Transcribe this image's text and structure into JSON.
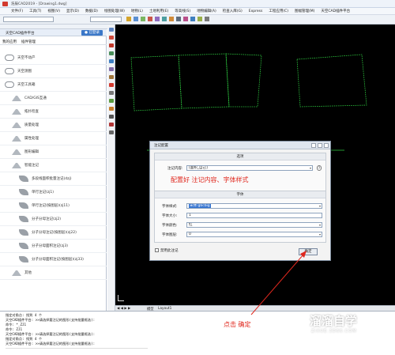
{
  "window": {
    "title": "浩辰CAD2019 - [Drawing1.dwg]"
  },
  "menu": [
    "文件(F)",
    "工具(T)",
    "视图(V)",
    "显示(D)",
    "数据(D)",
    "绘图处理(W)",
    "地物(L)",
    "土地利用(E)",
    "等高线(S)",
    "地物编辑(A)",
    "检查入库(G)",
    "Express",
    "工程应用(C)",
    "图幅管理(M)",
    "天空CAD插件平台"
  ],
  "panel": {
    "title": "天空CAD插件平台",
    "login": "已登录",
    "tabs": [
      "我的应用",
      "插件管理"
    ],
    "items": [
      {
        "label": "天空不动产",
        "icon": "cloud-icon",
        "level": 0
      },
      {
        "label": "天空测图",
        "icon": "cloud-icon",
        "level": 0
      },
      {
        "label": "天空工具箱",
        "icon": "cloud-icon",
        "level": 0
      },
      {
        "label": "CAD/GIS互通",
        "icon": "paper-plane-icon",
        "level": 1
      },
      {
        "label": "拓扑检查",
        "icon": "paper-plane-icon",
        "level": 1
      },
      {
        "label": "质量处理",
        "icon": "paper-plane-icon",
        "level": 1
      },
      {
        "label": "属性处理",
        "icon": "paper-plane-icon",
        "level": 1
      },
      {
        "label": "图形编辑",
        "icon": "paper-plane-icon",
        "level": 1
      },
      {
        "label": "智能注记",
        "icon": "paper-plane-icon",
        "level": 1
      },
      {
        "label": "多段线面积批量注记(dzj)",
        "icon": "leaf-icon",
        "level": 2
      },
      {
        "label": "单行注记(zj1)",
        "icon": "leaf-icon",
        "level": 2
      },
      {
        "label": "单行注记(按图层)(zj11)",
        "icon": "leaf-icon",
        "level": 2
      },
      {
        "label": "分子分母注记(zj2)",
        "icon": "leaf-icon",
        "level": 2
      },
      {
        "label": "分子分母注记(按图层)(zj22)",
        "icon": "leaf-icon",
        "level": 2
      },
      {
        "label": "分子分母面积注记(zj3)",
        "icon": "leaf-icon",
        "level": 2
      },
      {
        "label": "分子分母面积注记(按图层)(zj33)",
        "icon": "leaf-icon",
        "level": 2
      },
      {
        "label": "其他",
        "icon": "paper-plane-icon",
        "level": 1
      }
    ]
  },
  "cad_tabs": [
    "模型",
    "Layout1"
  ],
  "dialog": {
    "title": "注记配置",
    "section1": "选项",
    "content_label": "注记内容:",
    "content_value": "[面积_自己]",
    "section2": "字体",
    "font_style_label": "字体样式:",
    "font_style_value": "宋体:gbcbig",
    "font_size_label": "字体大小:",
    "font_size_value": "1",
    "font_color_label": "字体颜色:",
    "font_color_value": "红",
    "font_layer_label": "字体图层:",
    "font_layer_value": "0",
    "checkbox_label": "禁用此注记",
    "ok": "确定"
  },
  "annotations": {
    "config_note": "配置好 注记内容、字体样式",
    "click_note": "点击 确定"
  },
  "command_lines": [
    "指定对角点: 找到 4 个",
    "天空CAD插件平台: >>请选择要注记的图形(支持批量框选):",
    "命令:  *_ZJ1",
    "命令:  ZJ1",
    "天空CAD插件平台: >>请选择要注记的图形(支持批量框选):",
    "指定对角点: 找到 4 个",
    "天空CAD插件平台: >>请选择要注记的图形(支持批量框选):"
  ],
  "watermark": {
    "brand": "溜溜自学",
    "url": "ZIXUE.3D66.COM"
  },
  "colors": {
    "accent": "#3b78c8",
    "note_red": "#e0281e",
    "polyline_green": "#2ecc40"
  }
}
